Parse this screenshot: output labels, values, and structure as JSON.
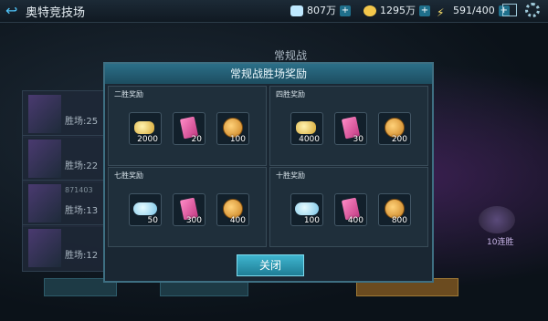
{
  "header": {
    "title": "奥特竞技场",
    "crystals": "807万",
    "coins": "1295万",
    "stamina": "591/400"
  },
  "side_list": [
    {
      "name": "",
      "label": "胜场:25"
    },
    {
      "name": "",
      "label": "胜场:22"
    },
    {
      "name": "871403",
      "label": "胜场:13"
    },
    {
      "name": "",
      "label": "胜场:12"
    }
  ],
  "background": {
    "mode": "常规战",
    "streak_label": "10连胜"
  },
  "modal": {
    "title": "常规战胜场奖励",
    "close_label": "关闭",
    "panels": [
      {
        "label": "二胜奖励",
        "items": [
          {
            "type": "gold",
            "count": "2000"
          },
          {
            "type": "book",
            "count": "20"
          },
          {
            "type": "medal",
            "count": "100"
          }
        ]
      },
      {
        "label": "四胜奖励",
        "items": [
          {
            "type": "gold",
            "count": "4000"
          },
          {
            "type": "book",
            "count": "30"
          },
          {
            "type": "medal",
            "count": "200"
          }
        ]
      },
      {
        "label": "七胜奖励",
        "items": [
          {
            "type": "gem",
            "count": "50"
          },
          {
            "type": "book",
            "count": "300"
          },
          {
            "type": "medal",
            "count": "400"
          }
        ]
      },
      {
        "label": "十胜奖励",
        "items": [
          {
            "type": "gem",
            "count": "100"
          },
          {
            "type": "book",
            "count": "400"
          },
          {
            "type": "medal",
            "count": "800"
          }
        ]
      }
    ]
  }
}
